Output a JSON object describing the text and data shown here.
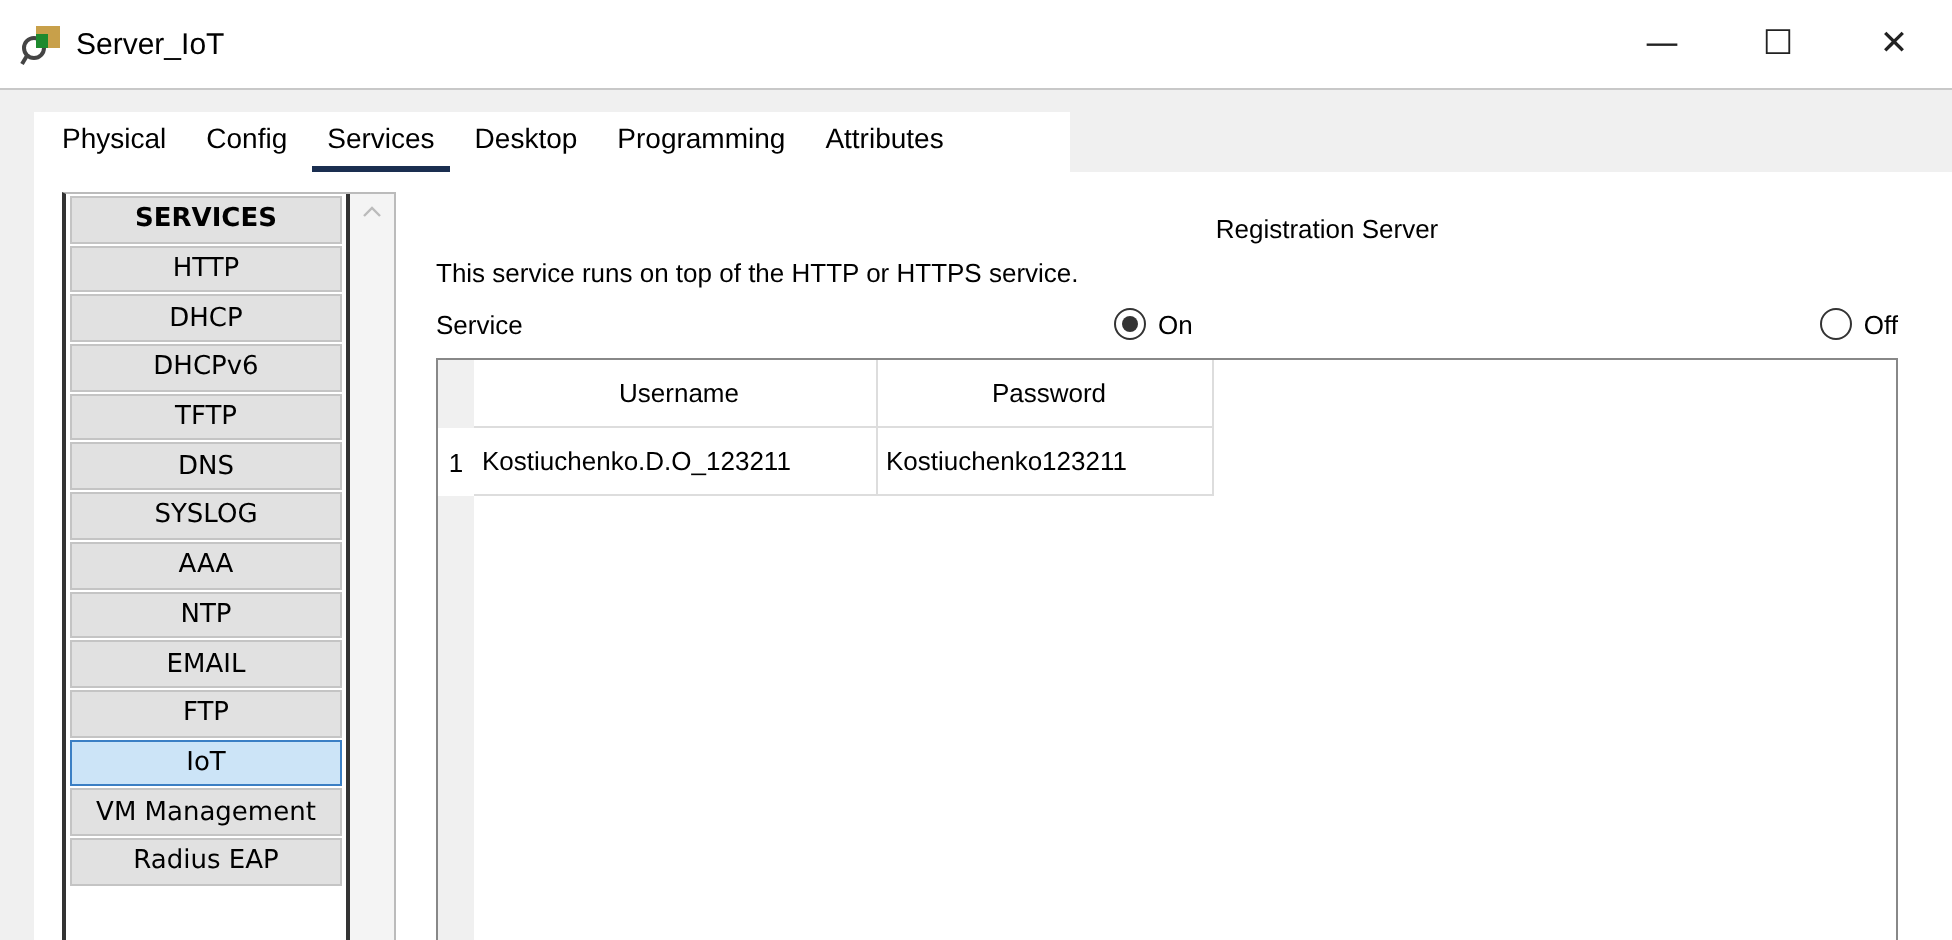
{
  "window": {
    "title": "Server_IoT",
    "controls": [
      "—",
      "☐",
      "✕"
    ]
  },
  "tabs": [
    {
      "label": "Physical",
      "selected": false
    },
    {
      "label": "Config",
      "selected": false
    },
    {
      "label": "Services",
      "selected": true
    },
    {
      "label": "Desktop",
      "selected": false
    },
    {
      "label": "Programming",
      "selected": false
    },
    {
      "label": "Attributes",
      "selected": false
    }
  ],
  "sidebar": {
    "header": "SERVICES",
    "items": [
      {
        "label": "HTTP",
        "selected": false
      },
      {
        "label": "DHCP",
        "selected": false
      },
      {
        "label": "DHCPv6",
        "selected": false
      },
      {
        "label": "TFTP",
        "selected": false
      },
      {
        "label": "DNS",
        "selected": false
      },
      {
        "label": "SYSLOG",
        "selected": false
      },
      {
        "label": "AAA",
        "selected": false
      },
      {
        "label": "NTP",
        "selected": false
      },
      {
        "label": "EMAIL",
        "selected": false
      },
      {
        "label": "FTP",
        "selected": false
      },
      {
        "label": "IoT",
        "selected": true
      },
      {
        "label": "VM Management",
        "selected": false
      },
      {
        "label": "Radius EAP",
        "selected": false
      }
    ]
  },
  "panel": {
    "title": "Registration Server",
    "note": "This service runs on top of the HTTP or HTTPS service.",
    "service_label": "Service",
    "options": [
      {
        "label": "On",
        "selected": true
      },
      {
        "label": "Off",
        "selected": false
      }
    ],
    "table": {
      "columns": [
        "Username",
        "Password"
      ],
      "rows": [
        {
          "index": "1",
          "cells": [
            "Kostiuchenko.D.O_123211",
            "Kostiuchenko123211"
          ]
        }
      ]
    }
  }
}
